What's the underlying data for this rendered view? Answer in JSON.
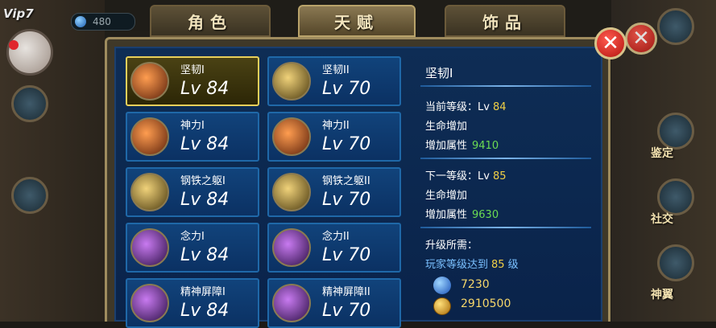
{
  "header": {
    "vip": "Vip7",
    "gems": "480"
  },
  "tabs": [
    {
      "label": "角色",
      "active": false
    },
    {
      "label": "天赋",
      "active": true
    },
    {
      "label": "饰品",
      "active": false
    }
  ],
  "side_labels": {
    "right1": "鉴定",
    "right2": "社交",
    "right3": "神翼"
  },
  "close_symbol": "✕",
  "talents": [
    {
      "name": "坚韧I",
      "lv": "Lv 84",
      "selected": true,
      "icon": "fire"
    },
    {
      "name": "坚韧II",
      "lv": "Lv 70",
      "selected": false,
      "icon": "gold"
    },
    {
      "name": "神力I",
      "lv": "Lv 84",
      "selected": false,
      "icon": "fire"
    },
    {
      "name": "神力II",
      "lv": "Lv 70",
      "selected": false,
      "icon": "fire"
    },
    {
      "name": "钢铁之躯I",
      "lv": "Lv 84",
      "selected": false,
      "icon": "gold"
    },
    {
      "name": "钢铁之躯II",
      "lv": "Lv 70",
      "selected": false,
      "icon": "gold"
    },
    {
      "name": "念力I",
      "lv": "Lv 84",
      "selected": false,
      "icon": "purple"
    },
    {
      "name": "念力II",
      "lv": "Lv 70",
      "selected": false,
      "icon": "purple"
    },
    {
      "name": "精神屏障I",
      "lv": "Lv 84",
      "selected": false,
      "icon": "purple"
    },
    {
      "name": "精神屏障II",
      "lv": "Lv 70",
      "selected": false,
      "icon": "purple"
    }
  ],
  "detail": {
    "title": "坚韧I",
    "current_label": "当前等级：Lv",
    "current_level": "84",
    "life_label1": "生命增加",
    "attr_label1": "增加属性",
    "attr_val1": "9410",
    "next_label": "下一等级：Lv",
    "next_level": "85",
    "life_label2": "生命增加",
    "attr_label2": "增加属性",
    "attr_val2": "9630",
    "upgrade_label": "升级所需：",
    "req_prefix": "玩家等级达到",
    "req_level": "85",
    "req_suffix": "级",
    "gem_cost": "7230",
    "gold_cost": "2910500"
  }
}
